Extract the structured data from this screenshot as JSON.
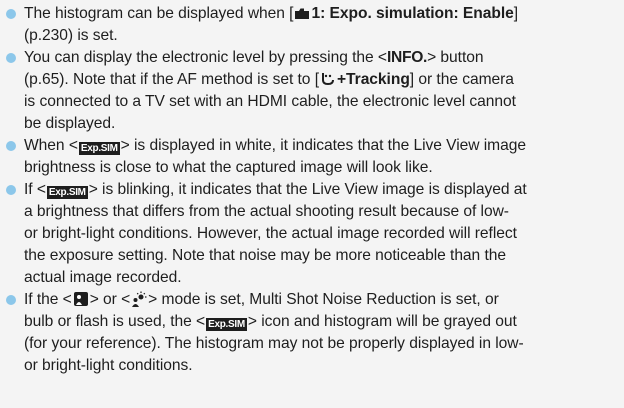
{
  "notes": [
    {
      "parts": {
        "a": "The histogram can be displayed when [",
        "b": "1: Expo. simulation: Enable",
        "c": "]",
        "d": "(p.230) is set."
      }
    },
    {
      "parts": {
        "a": "You can display the electronic level by pressing the <",
        "key": "INFO",
        "b": "> button",
        "c": "(p.65). Note that if the AF method is set to [",
        "d": "+Tracking",
        "e": "] or the camera",
        "f": "is connected to a TV set with an HDMI cable, the electronic level cannot",
        "g": "be displayed."
      }
    },
    {
      "parts": {
        "a": "When <",
        "chip": "Exp.SIM",
        "b": "> is displayed in white, it indicates that the Live View image",
        "c": "brightness is close to what the captured image will look like."
      }
    },
    {
      "parts": {
        "a": "If <",
        "chip": "Exp.SIM",
        "b": "> is blinking, it indicates that the Live View image is displayed at",
        "c": "a brightness that differs from the actual shooting result because of low-",
        "d": "or bright-light conditions. However, the actual image recorded will reflect",
        "e": "the exposure setting. Note that noise may be more noticeable than the",
        "f": "actual image recorded."
      }
    },
    {
      "parts": {
        "a": "If the <",
        "b": "> or <",
        "c": "> mode is set, Multi Shot Noise Reduction is set, or",
        "d": "bulb or flash is used, the <",
        "chip": "Exp.SIM",
        "e": "> icon and histogram will be grayed out",
        "f": "(for your reference). The histogram may not be properly displayed in low-",
        "g": "or bright-light conditions."
      }
    }
  ]
}
